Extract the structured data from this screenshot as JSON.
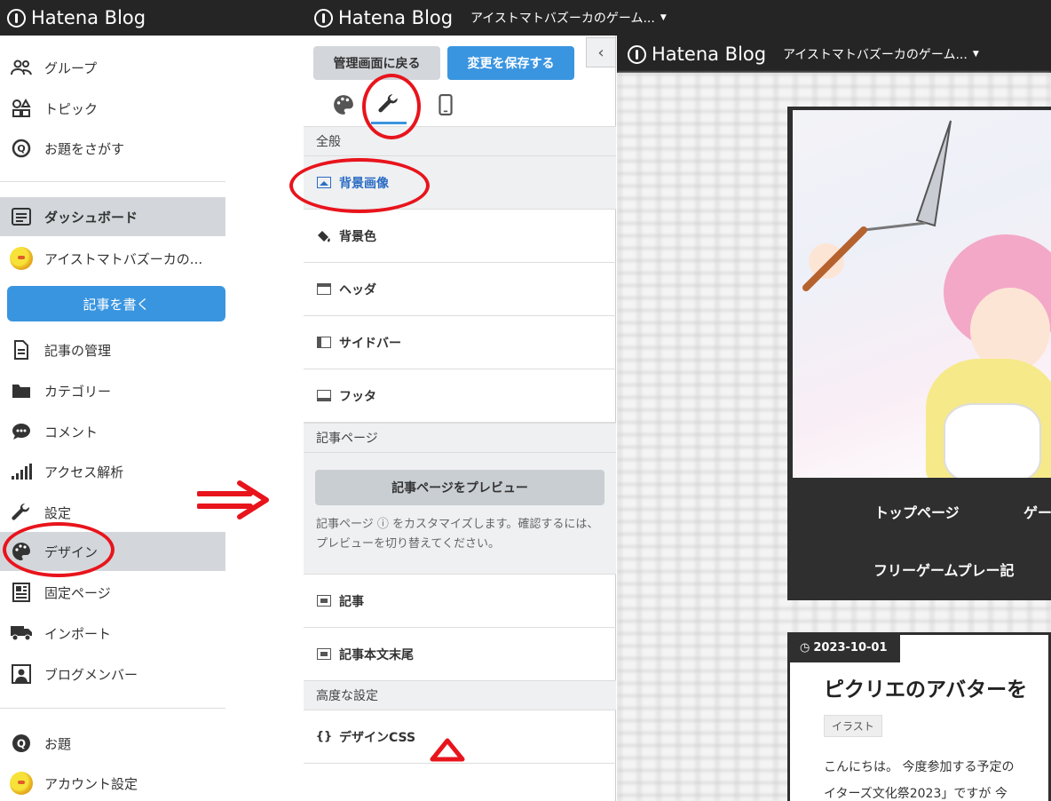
{
  "topbar": {
    "left_logo": "Hatena Blog",
    "center_logo": "Hatena Blog",
    "blog_name": "アイストマトバズーカのゲーム..."
  },
  "sidebar": {
    "items": [
      {
        "label": "グループ",
        "icon": "group-icon"
      },
      {
        "label": "トピック",
        "icon": "topic-icon"
      },
      {
        "label": "お題をさがす",
        "icon": "search-theme-icon"
      },
      {
        "label": "ダッシュボード",
        "icon": "dashboard-icon"
      },
      {
        "label": "アイストマトバズーカの...",
        "icon": "blog-avatar"
      },
      {
        "label": "記事の管理",
        "icon": "document-icon"
      },
      {
        "label": "カテゴリー",
        "icon": "folder-icon"
      },
      {
        "label": "コメント",
        "icon": "comment-icon"
      },
      {
        "label": "アクセス解析",
        "icon": "chart-bars-icon"
      },
      {
        "label": "設定",
        "icon": "wrench-icon"
      },
      {
        "label": "デザイン",
        "icon": "palette-icon"
      },
      {
        "label": "固定ページ",
        "icon": "page-icon"
      },
      {
        "label": "インポート",
        "icon": "truck-icon"
      },
      {
        "label": "ブログメンバー",
        "icon": "member-icon"
      },
      {
        "label": "お題",
        "icon": "theme-icon"
      },
      {
        "label": "アカウント設定",
        "icon": "account-avatar"
      }
    ],
    "write_button": "記事を書く"
  },
  "editor": {
    "back_button": "管理画面に戻る",
    "save_button": "変更を保存する",
    "collapse_glyph": "‹",
    "tabs": [
      {
        "icon": "palette-icon"
      },
      {
        "icon": "wrench-icon",
        "active": true
      },
      {
        "icon": "smartphone-icon"
      }
    ],
    "sections": {
      "general": "全般",
      "article_page": "記事ページ",
      "advanced": "高度な設定"
    },
    "items": {
      "background_image": "背景画像",
      "background_color": "背景色",
      "header": "ヘッダ",
      "sidebar": "サイドバー",
      "footer": "フッタ",
      "article": "記事",
      "article_footer": "記事本文末尾",
      "design_css": "デザインCSS"
    },
    "preview_button": "記事ページをプレビュー",
    "preview_note": "記事ページ ⓘ をカスタマイズします。確認するには、プレビューを切り替えてください。"
  },
  "preview": {
    "logo": "Hatena Blog",
    "blog_name": "アイストマトバズーカのゲーム...",
    "nav": [
      "トップページ",
      "ゲー",
      "フリーゲームプレー記"
    ],
    "post": {
      "date": "2023-10-01",
      "title": "ピクリエのアバターを",
      "tag": "イラスト",
      "body_line1": "こんにちは。 今度参加する予定の",
      "body_line2": "イターズ文化祭2023」ですが 今"
    }
  },
  "colors": {
    "accent_blue": "#3a95e0",
    "annotation_red": "#e8141c",
    "topbar": "#252525"
  }
}
